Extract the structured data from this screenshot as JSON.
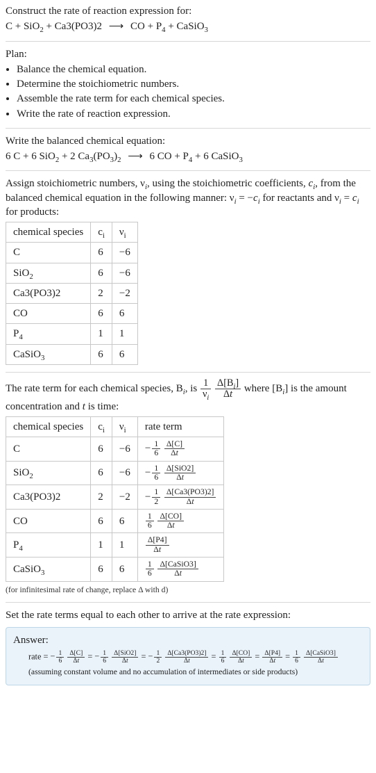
{
  "intro": {
    "title": "Construct the rate of reaction expression for:",
    "equation_unbalanced": {
      "lhs": [
        {
          "coef": "",
          "formula_html": "C"
        },
        {
          "coef": "",
          "formula_html": "SiO<sub>2</sub>"
        },
        {
          "coef": "",
          "formula_html": "Ca3(PO3)2"
        }
      ],
      "arrow": "⟶",
      "rhs": [
        {
          "coef": "",
          "formula_html": "CO"
        },
        {
          "coef": "",
          "formula_html": "P<sub>4</sub>"
        },
        {
          "coef": "",
          "formula_html": "CaSiO<sub>3</sub>"
        }
      ]
    }
  },
  "plan": {
    "label": "Plan:",
    "items": [
      "Balance the chemical equation.",
      "Determine the stoichiometric numbers.",
      "Assemble the rate term for each chemical species.",
      "Write the rate of reaction expression."
    ]
  },
  "balanced": {
    "title": "Write the balanced chemical equation:",
    "equation": {
      "lhs": [
        {
          "coef": "6",
          "formula_html": "C"
        },
        {
          "coef": "6",
          "formula_html": "SiO<sub>2</sub>"
        },
        {
          "coef": "2",
          "formula_html": "Ca<sub>3</sub>(PO<sub>3</sub>)<sub>2</sub>"
        }
      ],
      "arrow": "⟶",
      "rhs": [
        {
          "coef": "6",
          "formula_html": "CO"
        },
        {
          "coef": "",
          "formula_html": "P<sub>4</sub>"
        },
        {
          "coef": "6",
          "formula_html": "CaSiO<sub>3</sub>"
        }
      ]
    }
  },
  "stoich": {
    "intro_html": "Assign stoichiometric numbers, ν<sub><span class=\"ital\">i</span></sub>, using the stoichiometric coefficients, <span class=\"ital\">c</span><sub><span class=\"ital\">i</span></sub>, from the balanced chemical equation in the following manner: ν<sub><span class=\"ital\">i</span></sub> = −<span class=\"ital\">c</span><sub><span class=\"ital\">i</span></sub> for reactants and ν<sub><span class=\"ital\">i</span></sub> = <span class=\"ital\">c</span><sub><span class=\"ital\">i</span></sub> for products:",
    "headers": {
      "species": "chemical species",
      "ci": "c<sub>i</sub>",
      "vi": "ν<sub>i</sub>"
    },
    "rows": [
      {
        "species_html": "C",
        "ci": "6",
        "vi": "−6"
      },
      {
        "species_html": "SiO<sub>2</sub>",
        "ci": "6",
        "vi": "−6"
      },
      {
        "species_html": "Ca3(PO3)2",
        "ci": "2",
        "vi": "−2"
      },
      {
        "species_html": "CO",
        "ci": "6",
        "vi": "6"
      },
      {
        "species_html": "P<sub>4</sub>",
        "ci": "1",
        "vi": "1"
      },
      {
        "species_html": "CaSiO<sub>3</sub>",
        "ci": "6",
        "vi": "6"
      }
    ]
  },
  "rate_intro_html": "The rate term for each chemical species, B<sub><span class=\"ital\">i</span></sub>, is <span class=\"frac big\"><span class=\"num\">1</span><span class=\"den\">ν<sub><span class=\"ital\">i</span></sub></span></span> <span class=\"frac big\"><span class=\"num\">Δ[B<sub><span class=\"ital\">i</span></sub>]</span><span class=\"den\">Δ<span class=\"ital\">t</span></span></span> where [B<sub><span class=\"ital\">i</span></sub>] is the amount concentration and <span class=\"ital\">t</span> is time:",
  "rate_table": {
    "headers": {
      "species": "chemical species",
      "ci": "c<sub>i</sub>",
      "vi": "ν<sub>i</sub>",
      "rate": "rate term"
    },
    "rows": [
      {
        "species_html": "C",
        "ci": "6",
        "vi": "−6",
        "rate_html": "<span class=\"neg\">−</span><span class=\"frac\"><span class=\"num\">1</span><span class=\"den\">6</span></span> <span class=\"frac\"><span class=\"num\">Δ[C]</span><span class=\"den\">Δ<span class=\"ital\">t</span></span></span>"
      },
      {
        "species_html": "SiO<sub>2</sub>",
        "ci": "6",
        "vi": "−6",
        "rate_html": "<span class=\"neg\">−</span><span class=\"frac\"><span class=\"num\">1</span><span class=\"den\">6</span></span> <span class=\"frac\"><span class=\"num\">Δ[SiO2]</span><span class=\"den\">Δ<span class=\"ital\">t</span></span></span>"
      },
      {
        "species_html": "Ca3(PO3)2",
        "ci": "2",
        "vi": "−2",
        "rate_html": "<span class=\"neg\">−</span><span class=\"frac\"><span class=\"num\">1</span><span class=\"den\">2</span></span> <span class=\"frac\"><span class=\"num\">Δ[Ca3(PO3)2]</span><span class=\"den\">Δ<span class=\"ital\">t</span></span></span>"
      },
      {
        "species_html": "CO",
        "ci": "6",
        "vi": "6",
        "rate_html": "<span class=\"frac\"><span class=\"num\">1</span><span class=\"den\">6</span></span> <span class=\"frac\"><span class=\"num\">Δ[CO]</span><span class=\"den\">Δ<span class=\"ital\">t</span></span></span>"
      },
      {
        "species_html": "P<sub>4</sub>",
        "ci": "1",
        "vi": "1",
        "rate_html": "<span class=\"frac\"><span class=\"num\">Δ[P4]</span><span class=\"den\">Δ<span class=\"ital\">t</span></span></span>"
      },
      {
        "species_html": "CaSiO<sub>3</sub>",
        "ci": "6",
        "vi": "6",
        "rate_html": "<span class=\"frac\"><span class=\"num\">1</span><span class=\"den\">6</span></span> <span class=\"frac\"><span class=\"num\">Δ[CaSiO3]</span><span class=\"den\">Δ<span class=\"ital\">t</span></span></span>"
      }
    ],
    "note": "(for infinitesimal rate of change, replace Δ with d)"
  },
  "final": {
    "intro": "Set the rate terms equal to each other to arrive at the rate expression:",
    "answer_label": "Answer:",
    "rate_html": "rate = <span class=\"neg\">−</span><span class=\"frac\"><span class=\"num\">1</span><span class=\"den\">6</span></span> <span class=\"frac\"><span class=\"num\">Δ[C]</span><span class=\"den\">Δ<span class=\"ital\">t</span></span></span> = <span class=\"neg\">−</span><span class=\"frac\"><span class=\"num\">1</span><span class=\"den\">6</span></span> <span class=\"frac\"><span class=\"num\">Δ[SiO2]</span><span class=\"den\">Δ<span class=\"ital\">t</span></span></span> = <span class=\"neg\">−</span><span class=\"frac\"><span class=\"num\">1</span><span class=\"den\">2</span></span> <span class=\"frac\"><span class=\"num\">Δ[Ca3(PO3)2]</span><span class=\"den\">Δ<span class=\"ital\">t</span></span></span> = <span class=\"frac\"><span class=\"num\">1</span><span class=\"den\">6</span></span> <span class=\"frac\"><span class=\"num\">Δ[CO]</span><span class=\"den\">Δ<span class=\"ital\">t</span></span></span> = <span class=\"frac\"><span class=\"num\">Δ[P4]</span><span class=\"den\">Δ<span class=\"ital\">t</span></span></span> = <span class=\"frac\"><span class=\"num\">1</span><span class=\"den\">6</span></span> <span class=\"frac\"><span class=\"num\">Δ[CaSiO3]</span><span class=\"den\">Δ<span class=\"ital\">t</span></span></span>",
    "assumption": "(assuming constant volume and no accumulation of intermediates or side products)"
  }
}
